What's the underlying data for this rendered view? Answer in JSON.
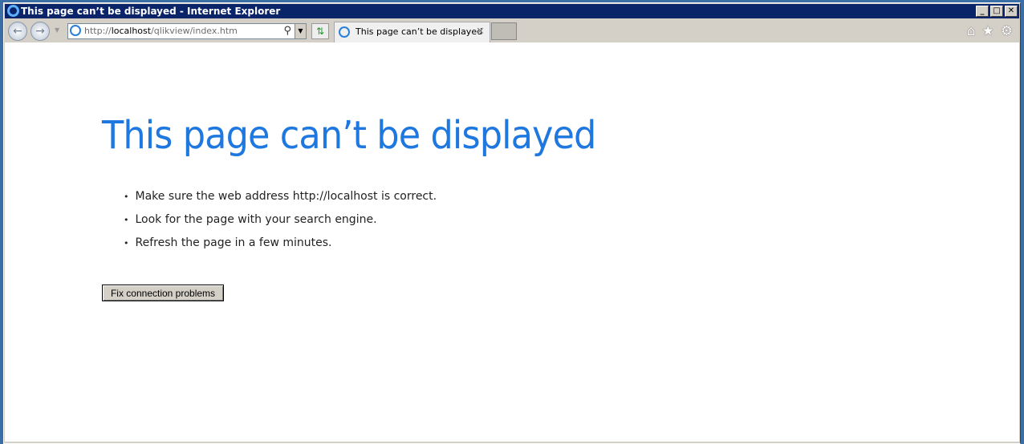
{
  "window": {
    "title": "This page can’t be displayed - Internet Explorer",
    "controls": [
      "_",
      "□",
      "✕"
    ]
  },
  "toolbar": {
    "address_prefix": "http://",
    "address_host": "localhost",
    "address_path": "/qlikview/index.htm",
    "tab_title": "This page can’t be displayed",
    "icons": [
      "home-icon",
      "favorites-star-icon",
      "gear-icon"
    ]
  },
  "page": {
    "heading": "This page can’t be displayed",
    "bullets": [
      "Make sure the web address http://localhost is correct.",
      "Look for the page with your search engine.",
      "Refresh the page in a few minutes."
    ],
    "button_label": "Fix connection problems"
  },
  "colors": {
    "heading": "#1e78e0",
    "titlebar": "#0a246a"
  }
}
